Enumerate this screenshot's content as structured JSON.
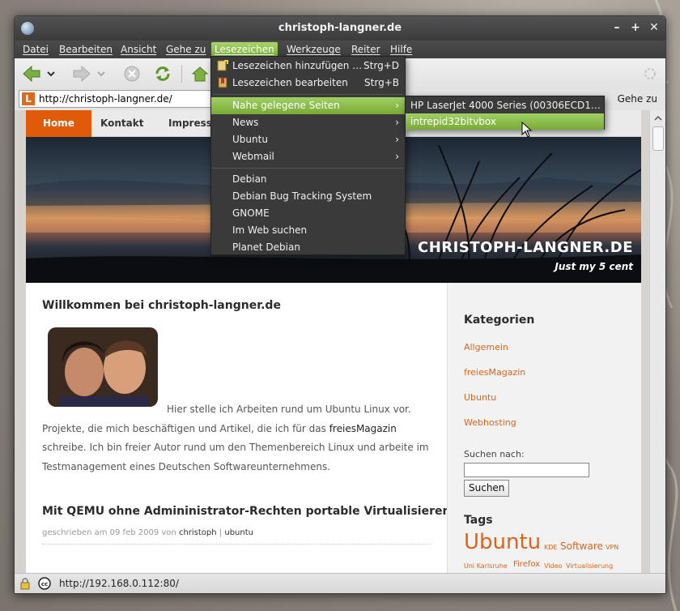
{
  "window": {
    "title": "christoph-langner.de"
  },
  "menubar": {
    "items": [
      "Datei",
      "Bearbeiten",
      "Ansicht",
      "Gehe zu",
      "Lesezeichen",
      "Werkzeuge",
      "Reiter",
      "Hilfe"
    ],
    "active": "Lesezeichen"
  },
  "location": {
    "url": "http://christoph-langner.de/",
    "go_label": "Gehe zu"
  },
  "bookmarks_menu": {
    "items": [
      {
        "label": "Lesezeichen hinzufügen …",
        "accel": "Strg+D"
      },
      {
        "label": "Lesezeichen bearbeiten",
        "accel": "Strg+B"
      },
      {
        "label": "Nahe gelegene Seiten"
      },
      {
        "label": "News"
      },
      {
        "label": "Ubuntu"
      },
      {
        "label": "Webmail"
      },
      {
        "label": "Debian"
      },
      {
        "label": "Debian Bug Tracking System"
      },
      {
        "label": "GNOME"
      },
      {
        "label": "Im Web suchen"
      },
      {
        "label": "Planet Debian"
      }
    ]
  },
  "submenu": {
    "items": [
      "HP LaserJet 4000 Series (00306ECD1…",
      "intrepid32bitvbox"
    ]
  },
  "site": {
    "nav": [
      "Home",
      "Kontakt",
      "Impressum"
    ],
    "banner_title": "CHRISTOPH-LANGNER.DE",
    "banner_subtitle": "Just my 5 cent",
    "welcome_heading": "Willkommen bei christoph-langner.de",
    "intro_line1": "Hier stelle ich Arbeiten rund um Ubuntu Linux vor.",
    "intro_line2a": "Projekte, die mich beschäftigen und Artikel, die ich für das ",
    "intro_link": "freiesMagazin",
    "intro_line3": "schreibe. Ich bin freier Autor rund um den Themenbereich Linux und arbeite im",
    "intro_line4": "Testmanagement eines Deutschen Softwareunternehmens.",
    "post_heading": "Mit QEMU ohne Admininistrator-Rechten portable Virtualisieren",
    "post_meta_prefix": "geschrieben am 09 feb 2009 von",
    "post_author": "christoph",
    "post_sep": "|",
    "post_category": "ubuntu",
    "sidebar": {
      "categories_heading": "Kategorien",
      "categories": [
        "Allgemein",
        "freiesMagazin",
        "Ubuntu",
        "Webhosting"
      ],
      "search_label": "Suchen nach:",
      "search_value": "",
      "search_button": "Suchen",
      "tags_heading": "Tags",
      "tags": [
        "Ubuntu",
        "KDE",
        "Software",
        "VPN",
        "Uni Karlsruhe",
        "Firefox",
        "Video",
        "Virtualisierung"
      ]
    }
  },
  "statusbar": {
    "text": "http://192.168.0.112:80/"
  },
  "colors": {
    "accent_green": "#8cc04f",
    "site_orange": "#e05a0a",
    "link_orange": "#d9641a",
    "menu_dark": "#3a3a3a"
  }
}
